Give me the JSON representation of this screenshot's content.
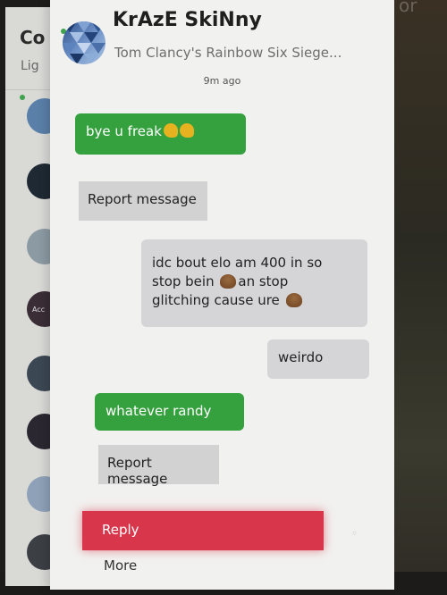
{
  "friends_panel": {
    "title": "Co",
    "subtitle": "Lig",
    "friends": [
      {
        "color": "#5a7fa8",
        "online": true,
        "label": ""
      },
      {
        "color": "#1f2933",
        "online": false,
        "label": ""
      },
      {
        "color": "#8c9aa3",
        "online": false,
        "label": ""
      },
      {
        "color": "#3a2d36",
        "online": false,
        "label": "Acc"
      },
      {
        "color": "#3b4753",
        "online": false,
        "label": ""
      },
      {
        "color": "#2a2730",
        "online": false,
        "label": ""
      },
      {
        "color": "#8fa1b8",
        "online": false,
        "label": ""
      },
      {
        "color": "#3c3f44",
        "online": false,
        "label": ""
      }
    ]
  },
  "chat": {
    "contact_name": "KrAzE SkiNny",
    "game_status": "Tom Clancy's Rainbow Six Siege...",
    "timestamp": "9m ago",
    "messages": [
      {
        "from": "me",
        "text": "bye u freak",
        "emoji": "flexed-biceps x2"
      },
      {
        "from": "them",
        "lines": [
          "idc bout elo am 400 in so",
          "stop bein",
          "an stop",
          "glitching cause ure"
        ],
        "emoji": "pile-of-poo"
      },
      {
        "from": "them",
        "text": "weirdo"
      },
      {
        "from": "me",
        "text": "whatever randy"
      }
    ],
    "report_label": "Report message"
  },
  "context_menu": {
    "reply_label": "Reply",
    "more_label": "More"
  },
  "colors": {
    "sent_bubble": "#35a13e",
    "received_bubble": "#d5d5d8",
    "reply_highlight": "#d8374b",
    "online": "#3fa34d"
  },
  "background": {
    "edge_text": "or"
  }
}
